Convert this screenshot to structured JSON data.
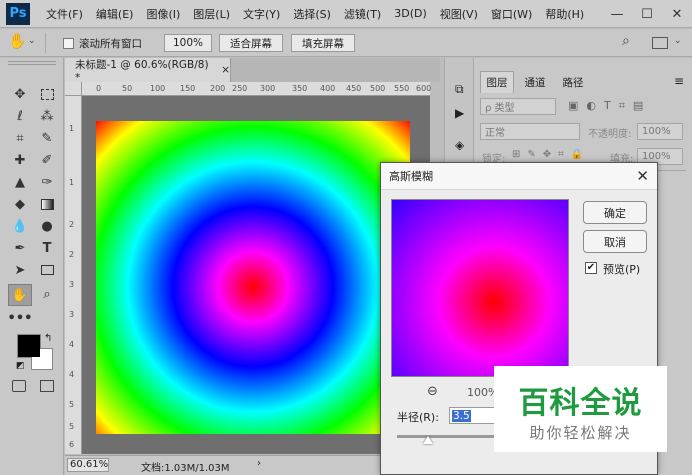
{
  "app": {
    "logo": "Ps",
    "menu": [
      "文件(F)",
      "编辑(E)",
      "图像(I)",
      "图层(L)",
      "文字(Y)",
      "选择(S)",
      "滤镜(T)",
      "3D(D)",
      "视图(V)",
      "窗口(W)",
      "帮助(H)"
    ],
    "window_controls": {
      "minimize": "—",
      "maximize": "☐",
      "close": "✕"
    }
  },
  "options": {
    "scroll_all_windows": "滚动所有窗口",
    "zoom_value": "100%",
    "fit_screen": "适合屏幕",
    "fill_screen": "填充屏幕"
  },
  "document": {
    "tab_title": "未标题-1 @ 60.6%(RGB/8) *",
    "ruler_h": [
      "0",
      "50",
      "100",
      "150",
      "200",
      "250",
      "300",
      "350",
      "400",
      "450",
      "500",
      "550",
      "600"
    ],
    "ruler_v": [
      "1",
      "1",
      "2",
      "2",
      "3",
      "3",
      "4",
      "4",
      "5",
      "5",
      "6"
    ],
    "zoom": "60.61%",
    "doc_info": "文档:1.03M/1.03M"
  },
  "layers_panel": {
    "tabs": [
      "图层",
      "通道",
      "路径"
    ],
    "kind_filter": "ρ 类型",
    "blend_mode": "正常",
    "opacity_label": "不透明度:",
    "opacity_value": "100%",
    "lock_label": "锁定:",
    "fill_label": "填充:",
    "fill_value": "100%"
  },
  "dialog": {
    "title": "高斯模糊",
    "ok": "确定",
    "cancel": "取消",
    "preview_label": "预览(P)",
    "preview_checked": true,
    "zoom_value": "100%",
    "radius_label": "半径(R):",
    "radius_value": "3.5"
  },
  "watermark": {
    "main": "百科全说",
    "sub": "助你轻松解决"
  }
}
